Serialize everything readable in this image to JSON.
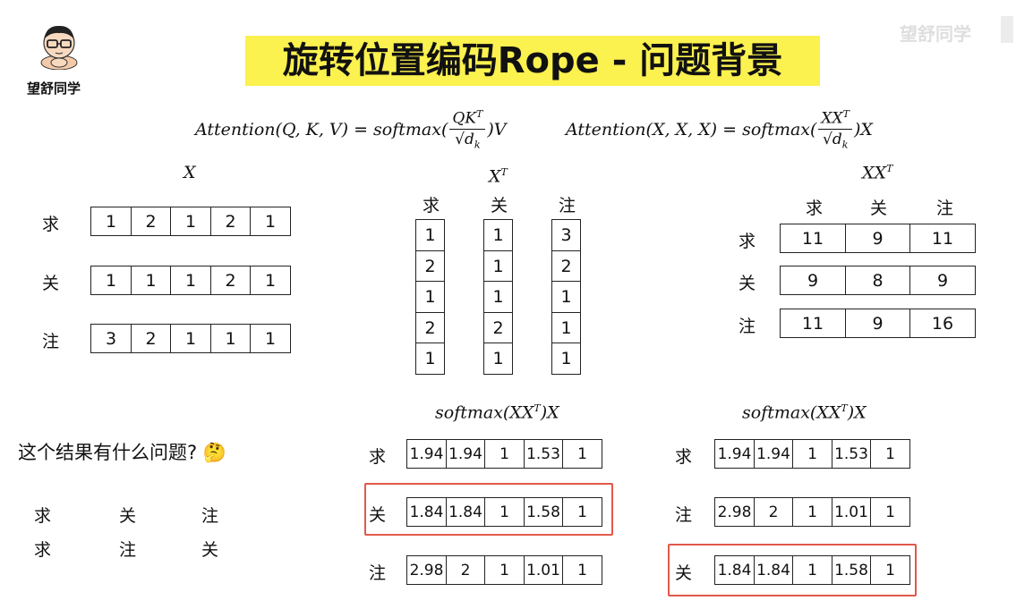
{
  "brand": {
    "name": "望舒同学",
    "watermark": "望舒同学"
  },
  "title": "旋转位置编码Rope - 问题背景",
  "formulas": {
    "attention_qkv": {
      "left": "Attention(Q, K, V) = softmax(",
      "num": "QK",
      "num_sup": "T",
      "den": "d",
      "den_sub": "k",
      "right": ")V"
    },
    "attention_xxx": {
      "left": "Attention(X, X, X) = softmax(",
      "num": "XX",
      "num_sup": "T",
      "den": "d",
      "den_sub": "k",
      "right": ")X"
    }
  },
  "x_matrix": {
    "label": "X",
    "rows": [
      {
        "token": "求",
        "values": [
          "1",
          "2",
          "1",
          "2",
          "1"
        ]
      },
      {
        "token": "关",
        "values": [
          "1",
          "1",
          "1",
          "2",
          "1"
        ]
      },
      {
        "token": "注",
        "values": [
          "3",
          "2",
          "1",
          "1",
          "1"
        ]
      }
    ]
  },
  "xt_matrix": {
    "label": "X",
    "label_sup": "T",
    "columns": [
      {
        "token": "求",
        "values": [
          "1",
          "2",
          "1",
          "2",
          "1"
        ]
      },
      {
        "token": "关",
        "values": [
          "1",
          "1",
          "1",
          "2",
          "1"
        ]
      },
      {
        "token": "注",
        "values": [
          "3",
          "2",
          "1",
          "1",
          "1"
        ]
      }
    ]
  },
  "xxt_matrix": {
    "label": "XX",
    "label_sup": "T",
    "headers": [
      "求",
      "关",
      "注"
    ],
    "rows": [
      {
        "token": "求",
        "values": [
          "11",
          "9",
          "11"
        ]
      },
      {
        "token": "关",
        "values": [
          "9",
          "8",
          "9"
        ]
      },
      {
        "token": "注",
        "values": [
          "11",
          "9",
          "16"
        ]
      }
    ]
  },
  "softmax_left": {
    "label_pre": "softmax(XX",
    "label_sup": "T",
    "label_post": ")X",
    "rows": [
      {
        "token": "求",
        "values": [
          "1.94",
          "1.94",
          "1",
          "1.53",
          "1"
        ]
      },
      {
        "token": "关",
        "values": [
          "1.84",
          "1.84",
          "1",
          "1.58",
          "1"
        ]
      },
      {
        "token": "注",
        "values": [
          "2.98",
          "2",
          "1",
          "1.01",
          "1"
        ]
      }
    ]
  },
  "softmax_right": {
    "label_pre": "softmax(XX",
    "label_sup": "T",
    "label_post": ")X",
    "rows": [
      {
        "token": "求",
        "values": [
          "1.94",
          "1.94",
          "1",
          "1.53",
          "1"
        ]
      },
      {
        "token": "注",
        "values": [
          "2.98",
          "2",
          "1",
          "1.01",
          "1"
        ]
      },
      {
        "token": "关",
        "values": [
          "1.84",
          "1.84",
          "1",
          "1.58",
          "1"
        ]
      }
    ]
  },
  "question": {
    "text": "这个结果有什么问题?",
    "emoji": "🤔"
  },
  "orders": [
    [
      "求",
      "关",
      "注"
    ],
    [
      "求",
      "注",
      "关"
    ]
  ],
  "colors": {
    "highlight_bg": "#fbf14f",
    "box_outline": "#e3584a"
  }
}
